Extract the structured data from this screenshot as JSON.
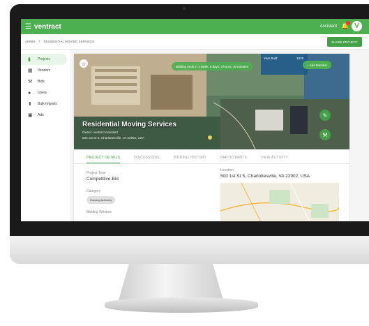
{
  "app": {
    "brand": "ventract",
    "assistant_label": "Assistant",
    "avatar_letter": "V"
  },
  "breadcrumb": {
    "root": "ADMIN",
    "current": "RESIDENTIAL MOVING SERVICES"
  },
  "share_button": "SHARE PROJECT",
  "sidebar": {
    "items": [
      {
        "label": "Projects",
        "icon": "file-icon"
      },
      {
        "label": "Vendors",
        "icon": "building-icon"
      },
      {
        "label": "Bids",
        "icon": "gavel-icon"
      },
      {
        "label": "Users",
        "icon": "user-icon"
      },
      {
        "label": "Bulk Imports",
        "icon": "upload-icon"
      },
      {
        "label": "Ads",
        "icon": "ad-icon"
      }
    ]
  },
  "hero": {
    "countdown": "Bidding ends in 1 week, 5 days, 2 hours, 30 minutes",
    "year_built_label": "Year Built:",
    "year_built_value": "1976",
    "add_member": "+ Add Member",
    "title": "Residential Moving Services",
    "owner": "Owner: ventract Assistant",
    "address": "500 1st St S, Charlottesville, VA 22902, USA"
  },
  "tabs": [
    "PROJECT DETAILS",
    "DISCUSSIONS",
    "BIDDING HISTORY",
    "PARTICIPANTS",
    "VIEW ACTIVITY"
  ],
  "details": {
    "project_type_label": "Project Type",
    "project_type_value": "Competitive-Bid",
    "category_label": "Category",
    "category_chip": "Housing Authority",
    "bidding_window_label": "Bidding Window",
    "location_label": "Location",
    "location_value": "500 1st St S, Charlottesville, VA 22902, USA"
  },
  "colors": {
    "brand_green": "#4caf50",
    "dark_green": "#43a047",
    "alert_red": "#e53935"
  }
}
